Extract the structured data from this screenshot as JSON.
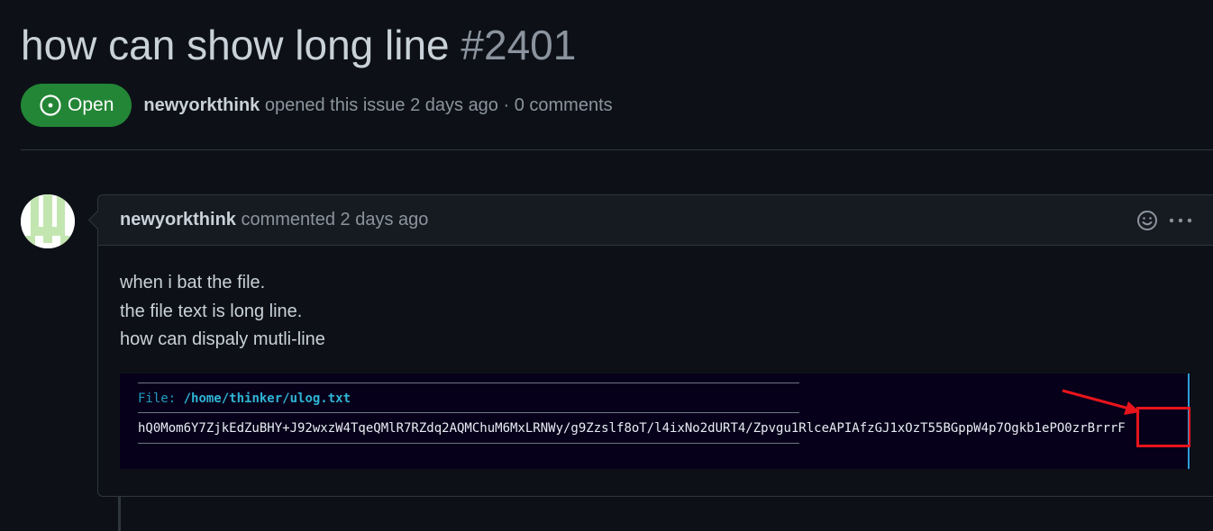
{
  "issue": {
    "title": "how can show long line",
    "number": "#2401",
    "status": "Open",
    "author": "newyorkthink",
    "opened_text": "opened this issue 2 days ago · 0 comments"
  },
  "comment": {
    "author": "newyorkthink",
    "time_text": "commented 2 days ago",
    "body_lines": [
      "when i bat the file.",
      "the file text is long line.",
      "how can dispaly mutli-line"
    ],
    "code": {
      "file_label": "File:",
      "file_path": "/home/thinker/ulog.txt",
      "content": "hQ0Mom6Y7ZjkEdZuBHY+J92wxzW4TqeQMlR7RZdq2AQMChuM6MxLRNWy/g9Zzslf8oT/l4ixNo2dURT4/Zpvgu1RlceAPIAfzGJ1xOzT55BGppW4p7Ogkb1ePO0zrBrrrF"
    }
  },
  "colors": {
    "background": "#0d1117",
    "open_badge": "#238636",
    "annotation": "#e8141c",
    "code_background": "#07001a"
  },
  "icons": [
    "issue-opened-icon",
    "smiley-icon",
    "kebab-horizontal-icon",
    "identicon-avatar"
  ]
}
